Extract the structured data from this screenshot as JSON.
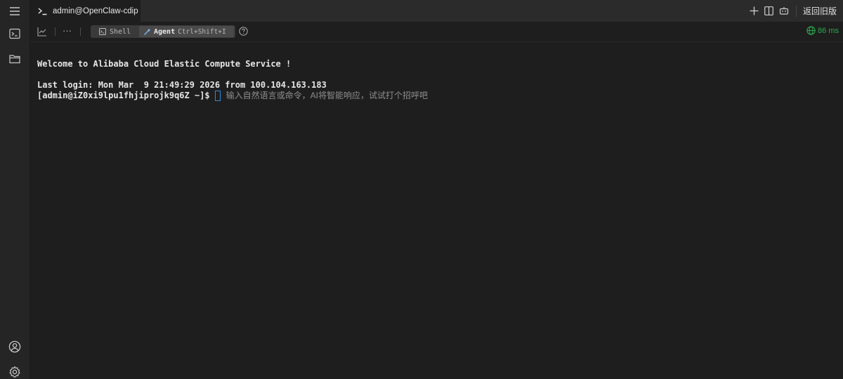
{
  "tab": {
    "title": "admin@OpenClaw-cdip"
  },
  "header_right": {
    "back_label": "返回旧版"
  },
  "toolbar": {
    "more_label": "···",
    "shell_label": "Shell",
    "agent_label": "Agent",
    "agent_shortcut": "Ctrl+Shift+I",
    "latency": "86 ms"
  },
  "terminal": {
    "welcome": "Welcome to Alibaba Cloud Elastic Compute Service !",
    "last_login": "Last login: Mon Mar  9 21:49:29 2026 from 100.104.163.183",
    "prompt": "[admin@iZ0xi9lpu1fhjiprojk9q6Z ~]$",
    "input_placeholder": "输入自然语言或命令，AI将智能响应，试试打个招呼吧"
  },
  "colors": {
    "background": "#1e1e1e",
    "rail": "#252526",
    "latency_green": "#2fa84f",
    "cursor_blue": "#2e8bd6"
  },
  "icons": [
    "menu-icon",
    "terminal-icon",
    "folder-icon",
    "user-icon",
    "settings-icon",
    "plus-icon",
    "split-view-icon",
    "robot-icon",
    "chart-icon",
    "help-icon",
    "globe-icon"
  ]
}
